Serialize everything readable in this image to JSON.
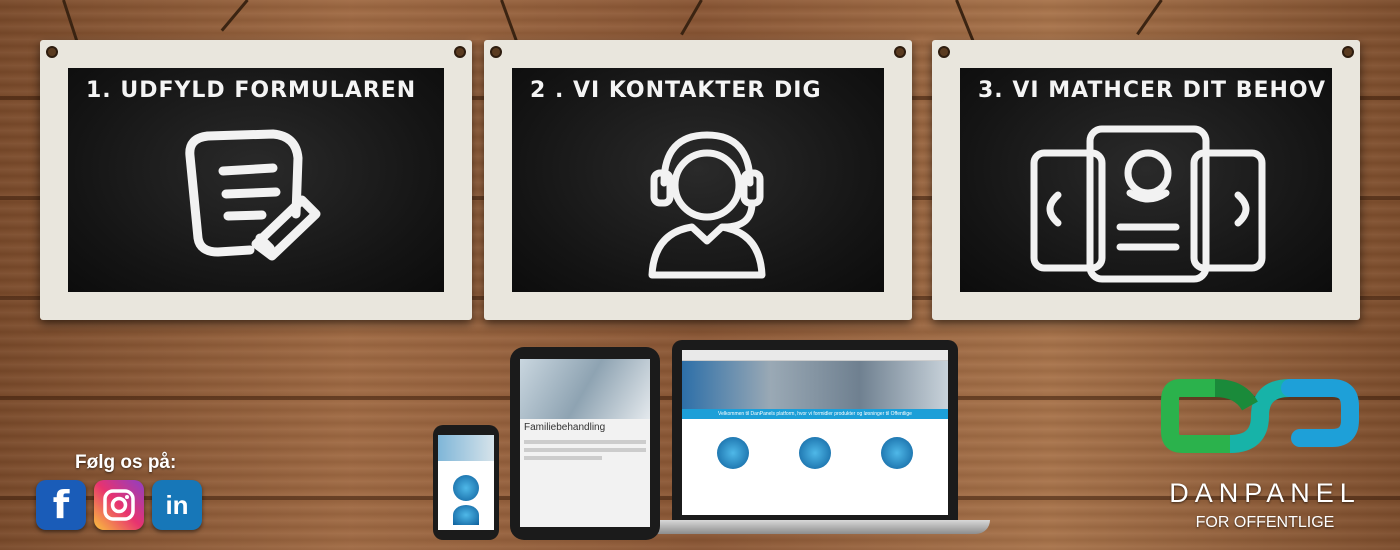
{
  "steps": [
    {
      "title": "1. UDFYLD FORMULAREN",
      "icon": "form-pencil-icon"
    },
    {
      "title": "2 . VI KONTAKTER DIG",
      "icon": "headset-agent-icon"
    },
    {
      "title": "3. VI MATHCER DIT BEHOV",
      "icon": "profile-cards-icon"
    }
  ],
  "social": {
    "label": "Følg os på:",
    "items": [
      {
        "name": "facebook",
        "glyph": "f"
      },
      {
        "name": "instagram",
        "glyph": ""
      },
      {
        "name": "linkedin",
        "glyph": "in"
      }
    ]
  },
  "devices": {
    "tablet_heading": "Familiebehandling",
    "laptop_banner": "Velkommen til DanPanels platform, hvor vi formidler produkter og løsninger til Offentlige"
  },
  "brand": {
    "name": "DANPANEL",
    "tagline": "FOR OFFENTLIGE",
    "colors": {
      "green": "#2bb24c",
      "blue": "#1ea0d8",
      "teal": "#17b3a8"
    }
  }
}
